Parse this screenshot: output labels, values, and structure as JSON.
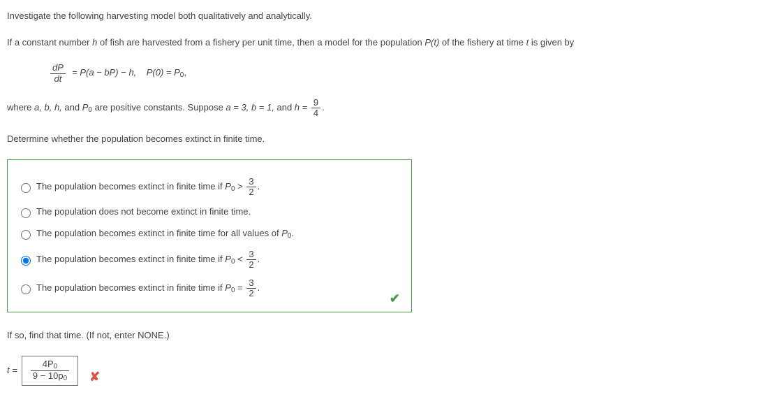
{
  "intro": "Investigate the following harvesting model both qualitatively and analytically.",
  "premise_a": "If a constant number ",
  "premise_h": "h",
  "premise_b": " of fish are harvested from a fishery per unit time, then a model for the population ",
  "premise_pt": "P(t)",
  "premise_c": " of the fishery at time ",
  "premise_t": "t",
  "premise_d": " is given by",
  "eq": {
    "dP": "dP",
    "dt": "dt",
    "mid": " = P(a − bP) − h,    P(0) = P",
    "sub0": "0",
    "comma": ","
  },
  "where_a": "where ",
  "where_vars": "a, b, h,",
  "where_b": " and ",
  "where_P": "P",
  "where_sub0": "0",
  "where_c": " are positive constants. Suppose ",
  "where_vals": "a = 3, b = 1,",
  "where_d": " and ",
  "where_h": "h = ",
  "frac94_n": "9",
  "frac94_d": "4",
  "period": ".",
  "question1": "Determine whether the population becomes extinct in finite time.",
  "opt_pref_ft": "The population becomes extinct in finite time if ",
  "opt_P": "P",
  "opt_sub0": "0",
  "gt": " > ",
  "lt": " < ",
  "eqsym": " = ",
  "frac32_n": "3",
  "frac32_d": "2",
  "opt2": "The population does not become extinct in finite time.",
  "opt3_pre": "The population becomes extinct in finite time for all values of ",
  "question2": "If so, find that time. (If not, enter NONE.)",
  "ans_label": "t =",
  "ans_num_a": "4P",
  "ans_num_sub": "0",
  "ans_den": "9 − 10p",
  "ans_den_sub": "0"
}
